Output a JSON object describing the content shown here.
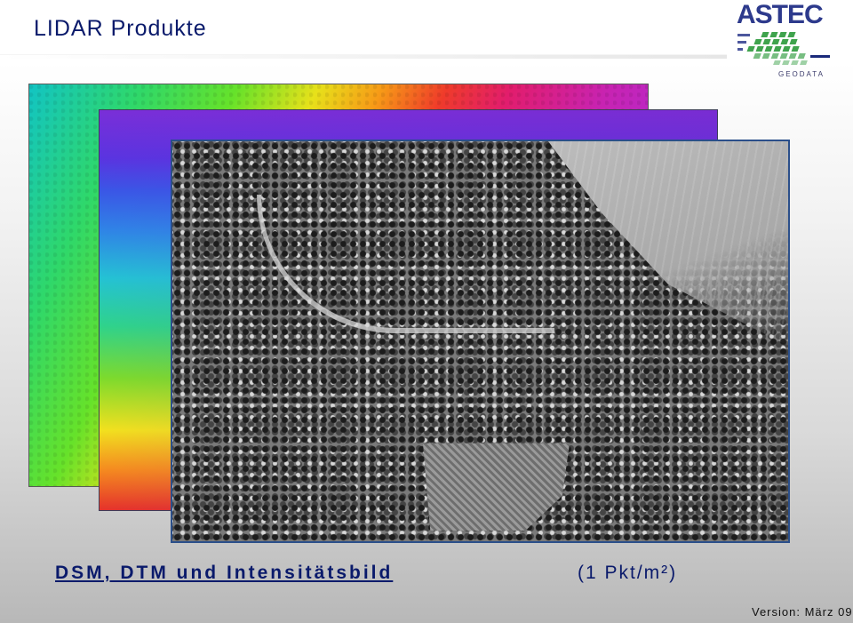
{
  "title": "LIDAR Produkte",
  "logo": {
    "name": "ASTEC",
    "subtitle": "GEODATA"
  },
  "layers": [
    {
      "name": "DSM"
    },
    {
      "name": "DTM"
    },
    {
      "name": "Intensitätsbild"
    }
  ],
  "caption": {
    "products": "DSM, DTM und Intensitätsbild",
    "density": "(1 Pkt/m²)"
  },
  "version": "Version: März 09",
  "colors": {
    "title": "#0a1a6b",
    "logo": "#2d3a8c",
    "logo_green": "#3fa34d"
  }
}
